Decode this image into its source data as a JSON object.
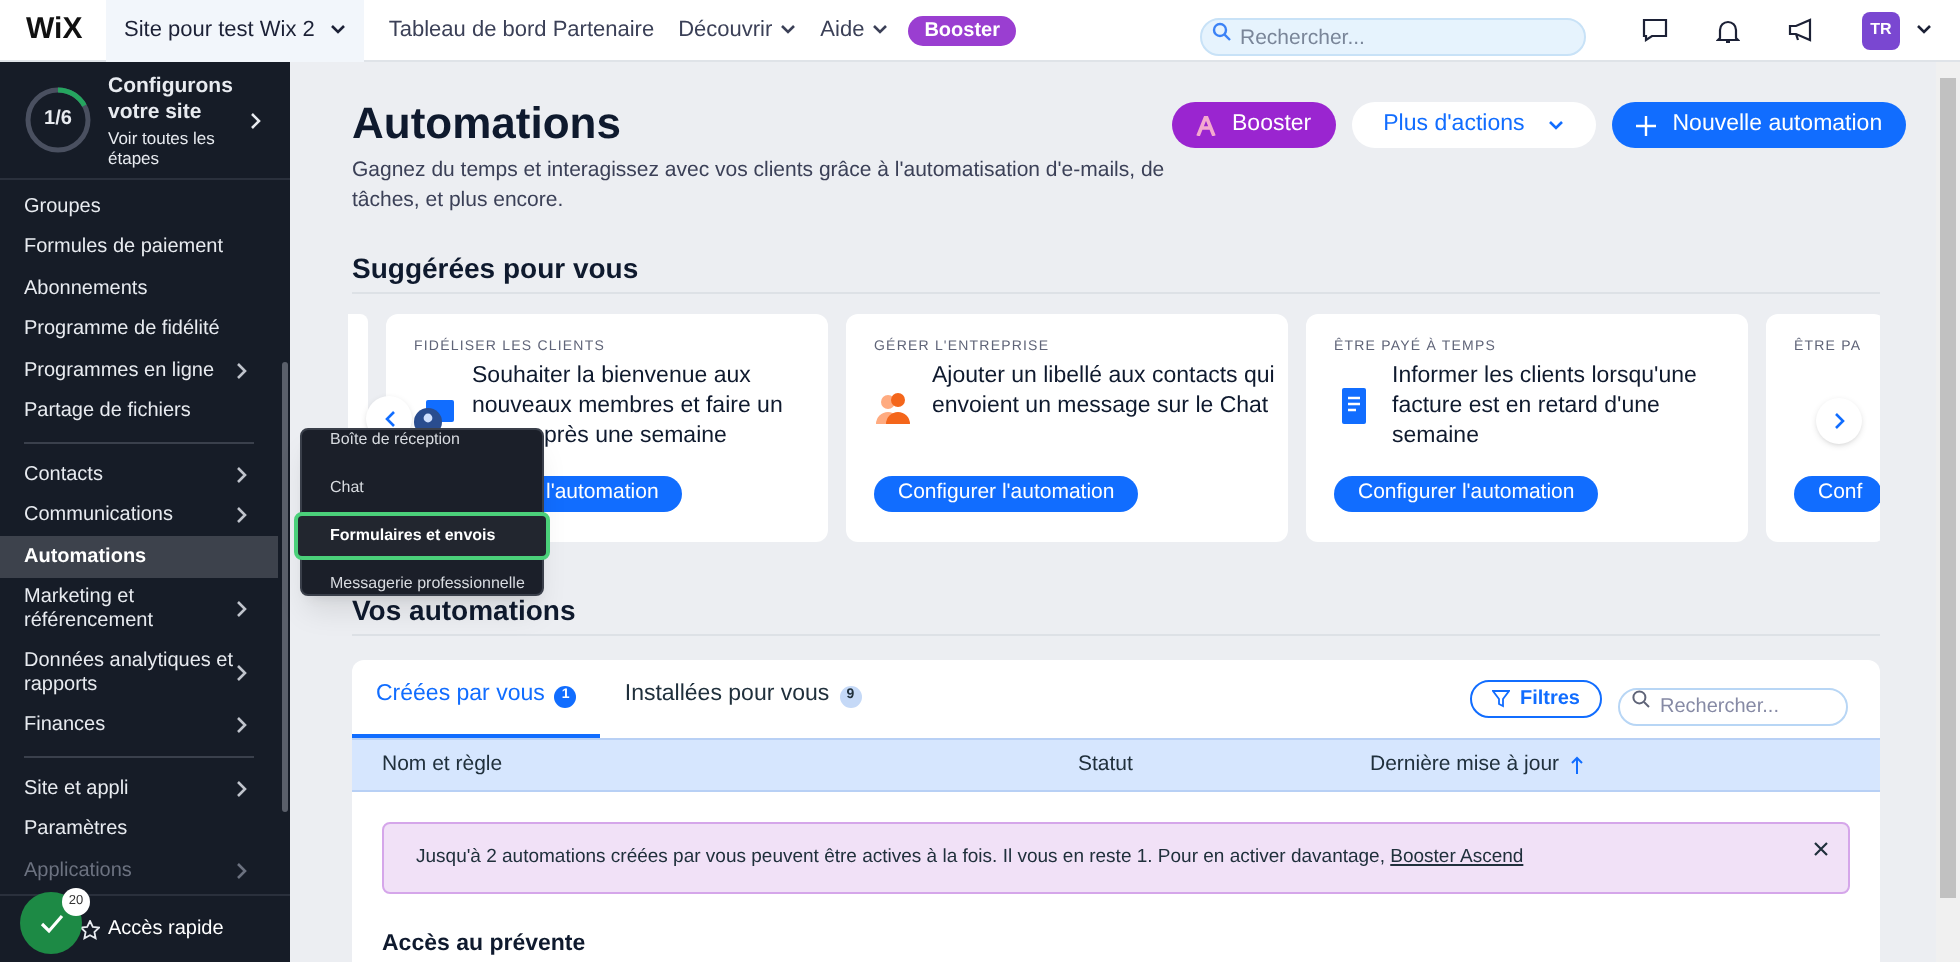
{
  "topbar": {
    "logo": "WiX",
    "site": "Site pour test Wix 2",
    "links": [
      {
        "label": "Tableau de bord Partenaire",
        "dropdown": false
      },
      {
        "label": "Découvrir",
        "dropdown": true
      },
      {
        "label": "Aide",
        "dropdown": true
      }
    ],
    "booster": "Booster",
    "search": {
      "placeholder": "Rechercher..."
    },
    "avatar": "TR"
  },
  "setup": {
    "progress": "1/6",
    "level": 0.17,
    "title": "Configurons votre site",
    "link": "Voir toutes les étapes"
  },
  "sidebar": {
    "groups": [
      [
        {
          "label": "Groupes",
          "submenu": false,
          "selected": false,
          "disabled": false
        },
        {
          "label": "Formules de paiement",
          "submenu": false,
          "selected": false,
          "disabled": false
        },
        {
          "label": "Abonnements",
          "submenu": false,
          "selected": false,
          "disabled": false
        },
        {
          "label": "Programme de fidélité",
          "submenu": false,
          "selected": false,
          "disabled": false
        },
        {
          "label": "Programmes en ligne",
          "submenu": true,
          "selected": false,
          "disabled": false
        },
        {
          "label": "Partage de fichiers",
          "submenu": false,
          "selected": false,
          "disabled": false
        }
      ],
      [
        {
          "label": "Contacts",
          "submenu": true,
          "selected": false,
          "disabled": false
        },
        {
          "label": "Communications",
          "submenu": true,
          "selected": false,
          "disabled": false
        },
        {
          "label": "Automations",
          "submenu": false,
          "selected": true,
          "disabled": false
        },
        {
          "label": "Marketing et référencement",
          "submenu": true,
          "selected": false,
          "disabled": false
        },
        {
          "label": "Données analytiques et rapports",
          "submenu": true,
          "selected": false,
          "disabled": false
        },
        {
          "label": "Finances",
          "submenu": true,
          "selected": false,
          "disabled": false
        }
      ],
      [
        {
          "label": "Site et appli",
          "submenu": true,
          "selected": false,
          "disabled": false
        },
        {
          "label": "Paramètres",
          "submenu": false,
          "selected": false,
          "disabled": false
        },
        {
          "label": "Applications",
          "submenu": true,
          "selected": false,
          "disabled": true
        }
      ]
    ],
    "quick_access": "Accès rapide",
    "badge": "20"
  },
  "popup_menu": [
    {
      "label": "Boîte de réception",
      "selected": false
    },
    {
      "label": "Chat",
      "selected": false
    },
    {
      "label": "Formulaires et envois",
      "selected": true
    },
    {
      "label": "Messagerie professionnelle",
      "selected": false
    }
  ],
  "page": {
    "title": "Automations",
    "subtitle": "Gagnez du temps et interagissez avec vos clients grâce à l'automatisation d'e-mails, de tâches, et plus encore.",
    "buttons": {
      "booster": "Booster",
      "more": "Plus d'actions",
      "new": "Nouvelle automation"
    }
  },
  "suggested": {
    "title": "Suggérées pour vous",
    "cards": [
      {
        "category": "FIDÉLISER LES CLIENTS",
        "lines": [
          "Souhaiter la bienvenue aux",
          "nouveaux membres et faire un",
          "près une semaine"
        ],
        "button": "l'automation",
        "kind": "covered"
      },
      {
        "category": "GÉRER L'ENTREPRISE",
        "lines": [
          "Ajouter un libellé aux contacts qui",
          "envoient un message sur le Chat"
        ],
        "button": "Configurer l'automation",
        "kind": "full"
      },
      {
        "category": "ÊTRE PAYÉ À TEMPS",
        "lines": [
          "Informer les clients lorsqu'une",
          "facture est en retard d'une",
          "semaine"
        ],
        "button": "Configurer l'automation",
        "kind": "full"
      },
      {
        "category": "ÊTRE PA",
        "button": "Conf",
        "kind": "cut"
      }
    ]
  },
  "automations": {
    "title": "Vos automations",
    "tabs": [
      {
        "label": "Créées par vous",
        "count": "1",
        "selected": true
      },
      {
        "label": "Installées pour vous",
        "count": "9",
        "selected": false
      }
    ],
    "filters": "Filtres",
    "search": {
      "placeholder": "Rechercher..."
    },
    "columns": [
      {
        "label": "Nom et règle",
        "sorted": false
      },
      {
        "label": "Statut",
        "sorted": false
      },
      {
        "label": "Dernière mise à jour",
        "sorted": true
      }
    ],
    "banner": {
      "text": "Jusqu'à 2 automations créées par vous peuvent être actives à la fois. Il vous en reste 1. Pour en activer davantage,",
      "link": "Booster Ascend"
    },
    "section": "Accès au prévente"
  }
}
